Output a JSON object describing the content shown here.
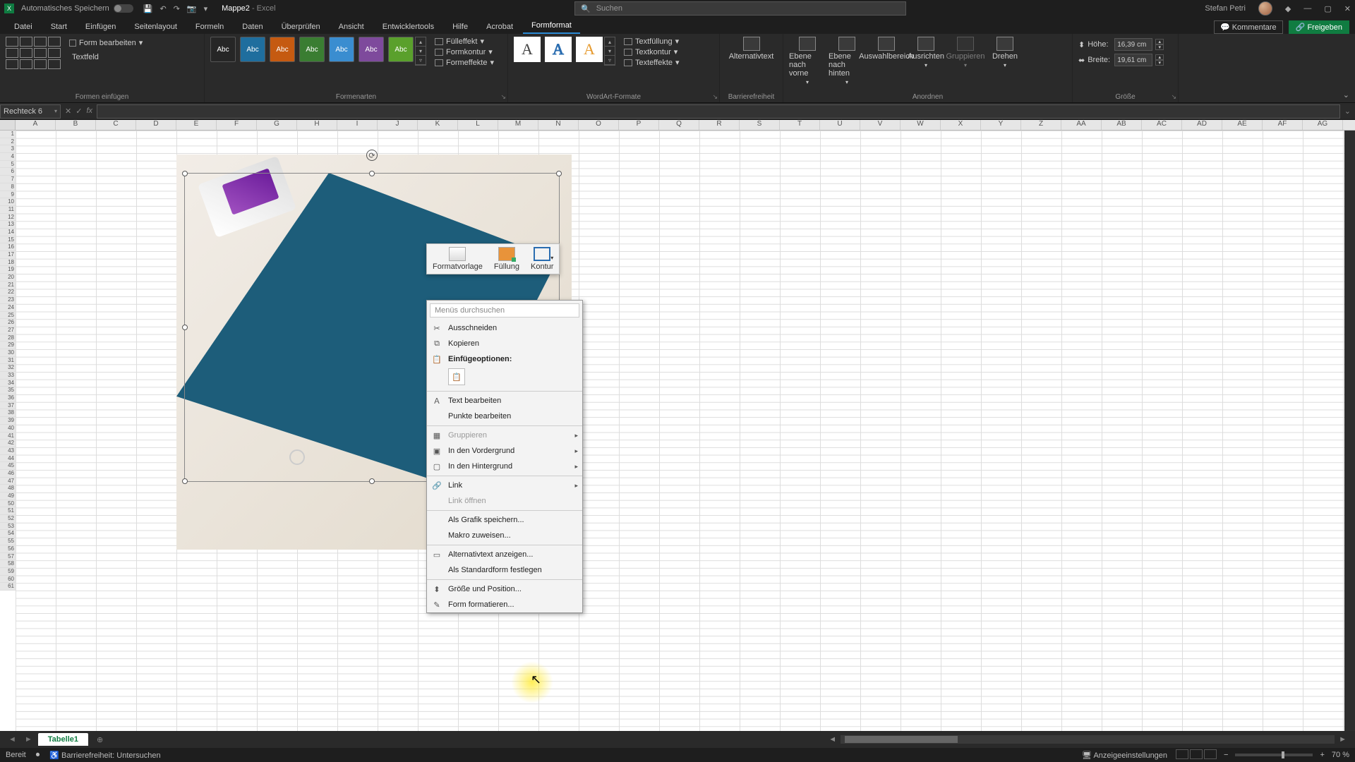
{
  "titlebar": {
    "autosave_label": "Automatisches Speichern",
    "file_name": "Mappe2",
    "app_name": "Excel",
    "search_placeholder": "Suchen",
    "user_name": "Stefan Petri"
  },
  "menubar": {
    "items": [
      "Datei",
      "Start",
      "Einfügen",
      "Seitenlayout",
      "Formeln",
      "Daten",
      "Überprüfen",
      "Ansicht",
      "Entwicklertools",
      "Hilfe",
      "Acrobat",
      "Formformat"
    ],
    "comments": "Kommentare",
    "share": "Freigeben"
  },
  "ribbon": {
    "insert_shapes": {
      "form_edit": "Form bearbeiten",
      "textfeld": "Textfeld",
      "group": "Formen einfügen"
    },
    "shape_styles": {
      "fill": "Fülleffekt",
      "outline": "Formkontur",
      "effects": "Formeffekte",
      "group": "Formenarten",
      "swatch": "Abc"
    },
    "wordart": {
      "textfill": "Textfüllung",
      "textoutline": "Textkontur",
      "texteffects": "Texteffekte",
      "group": "WordArt-Formate"
    },
    "accessibility": {
      "label": "Alternativtext",
      "group": "Barrierefreiheit"
    },
    "arrange": {
      "forward": "Ebene nach vorne",
      "backward": "Ebene nach hinten",
      "selection": "Auswahlbereich",
      "align": "Ausrichten",
      "group_btn": "Gruppieren",
      "rotate": "Drehen",
      "group": "Anordnen"
    },
    "size": {
      "height_label": "Höhe:",
      "height_val": "16,39 cm",
      "width_label": "Breite:",
      "width_val": "19,61 cm",
      "group": "Größe"
    }
  },
  "namebox": "Rechteck 6",
  "columns": [
    "A",
    "B",
    "C",
    "D",
    "E",
    "F",
    "G",
    "H",
    "I",
    "J",
    "K",
    "L",
    "M",
    "N",
    "O",
    "P",
    "Q",
    "R",
    "S",
    "T",
    "U",
    "V",
    "W",
    "X",
    "Y",
    "Z",
    "AA",
    "AB",
    "AC",
    "AD",
    "AE",
    "AF",
    "AG"
  ],
  "rowcount": 61,
  "minitoolbar": {
    "style": "Formatvorlage",
    "fill": "Füllung",
    "outline": "Kontur"
  },
  "context_menu": {
    "search_placeholder": "Menüs durchsuchen",
    "cut": "Ausschneiden",
    "copy": "Kopieren",
    "paste_options": "Einfügeoptionen:",
    "edit_text": "Text bearbeiten",
    "edit_points": "Punkte bearbeiten",
    "group": "Gruppieren",
    "bring_front": "In den Vordergrund",
    "send_back": "In den Hintergrund",
    "link": "Link",
    "open_link": "Link öffnen",
    "save_graphic": "Als Grafik speichern...",
    "assign_macro": "Makro zuweisen...",
    "alt_text": "Alternativtext anzeigen...",
    "set_default": "Als Standardform festlegen",
    "size_pos": "Größe und Position...",
    "format_shape": "Form formatieren..."
  },
  "sheet_tabs": {
    "tab1": "Tabelle1"
  },
  "statusbar": {
    "ready": "Bereit",
    "accessibility": "Barrierefreiheit: Untersuchen",
    "display_settings": "Anzeigeeinstellungen",
    "zoom": "70 %"
  }
}
